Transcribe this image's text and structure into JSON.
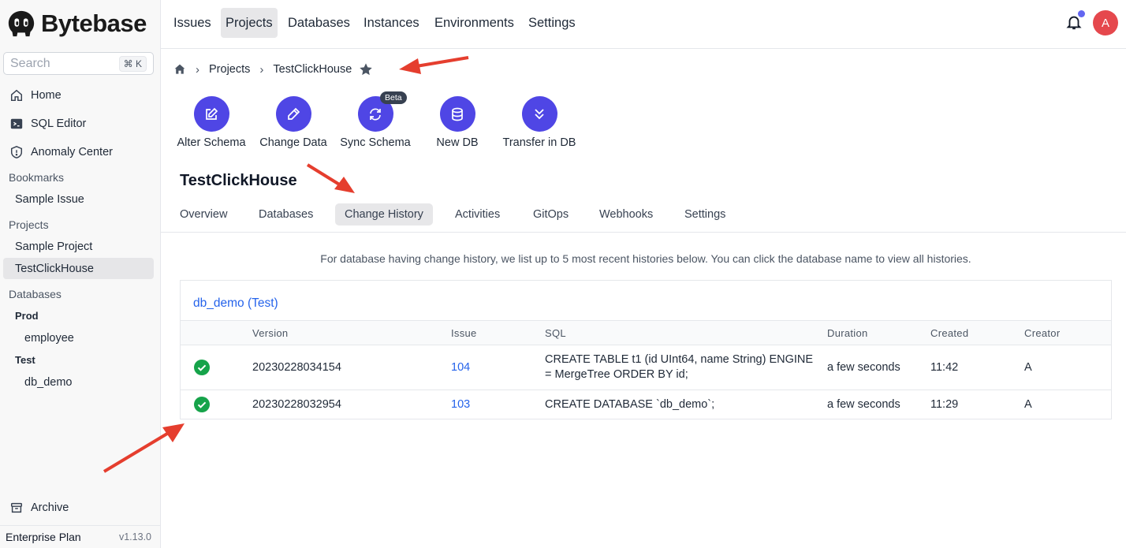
{
  "app": {
    "name": "Bytebase"
  },
  "sidebar": {
    "search_placeholder": "Search",
    "search_shortcut": "⌘ K",
    "nav": [
      {
        "label": "Home",
        "icon": "home-icon"
      },
      {
        "label": "SQL Editor",
        "icon": "terminal-icon"
      },
      {
        "label": "Anomaly Center",
        "icon": "shield-icon"
      }
    ],
    "bookmarks_label": "Bookmarks",
    "bookmarks": [
      "Sample Issue"
    ],
    "projects_label": "Projects",
    "projects": [
      "Sample Project",
      "TestClickHouse"
    ],
    "databases_label": "Databases",
    "env_prod": "Prod",
    "db_prod": "employee",
    "env_test": "Test",
    "db_test": "db_demo",
    "archive_label": "Archive",
    "plan": "Enterprise Plan",
    "version": "v1.13.0"
  },
  "topnav": {
    "items": [
      "Issues",
      "Projects",
      "Databases",
      "Instances",
      "Environments",
      "Settings"
    ],
    "active": "Projects",
    "avatar_letter": "A"
  },
  "breadcrumb": {
    "projects": "Projects",
    "current": "TestClickHouse"
  },
  "quick_actions": {
    "items": [
      "Alter Schema",
      "Change Data",
      "Sync Schema",
      "New DB",
      "Transfer in DB"
    ],
    "beta_badge": "Beta"
  },
  "project": {
    "title": "TestClickHouse",
    "tabs": [
      "Overview",
      "Databases",
      "Change History",
      "Activities",
      "GitOps",
      "Webhooks",
      "Settings"
    ],
    "active_tab": "Change History"
  },
  "change_history": {
    "info": "For database having change history, we list up to 5 most recent histories below. You can click the database name to view all histories.",
    "database_title": "db_demo (Test)",
    "columns": [
      "Version",
      "Issue",
      "SQL",
      "Duration",
      "Created",
      "Creator"
    ],
    "rows": [
      {
        "status": "success",
        "version": "20230228034154",
        "issue": "104",
        "sql": "CREATE TABLE t1 (id UInt64, name String) ENGINE = MergeTree ORDER BY id;",
        "duration": "a few seconds",
        "created": "11:42",
        "creator": "A"
      },
      {
        "status": "success",
        "version": "20230228032954",
        "issue": "103",
        "sql": "CREATE DATABASE `db_demo`;",
        "duration": "a few seconds",
        "created": "11:29",
        "creator": "A"
      }
    ]
  },
  "colors": {
    "accent": "#4f46e5",
    "link": "#2563eb",
    "success": "#16a34a",
    "annotation": "#e53e2e"
  }
}
